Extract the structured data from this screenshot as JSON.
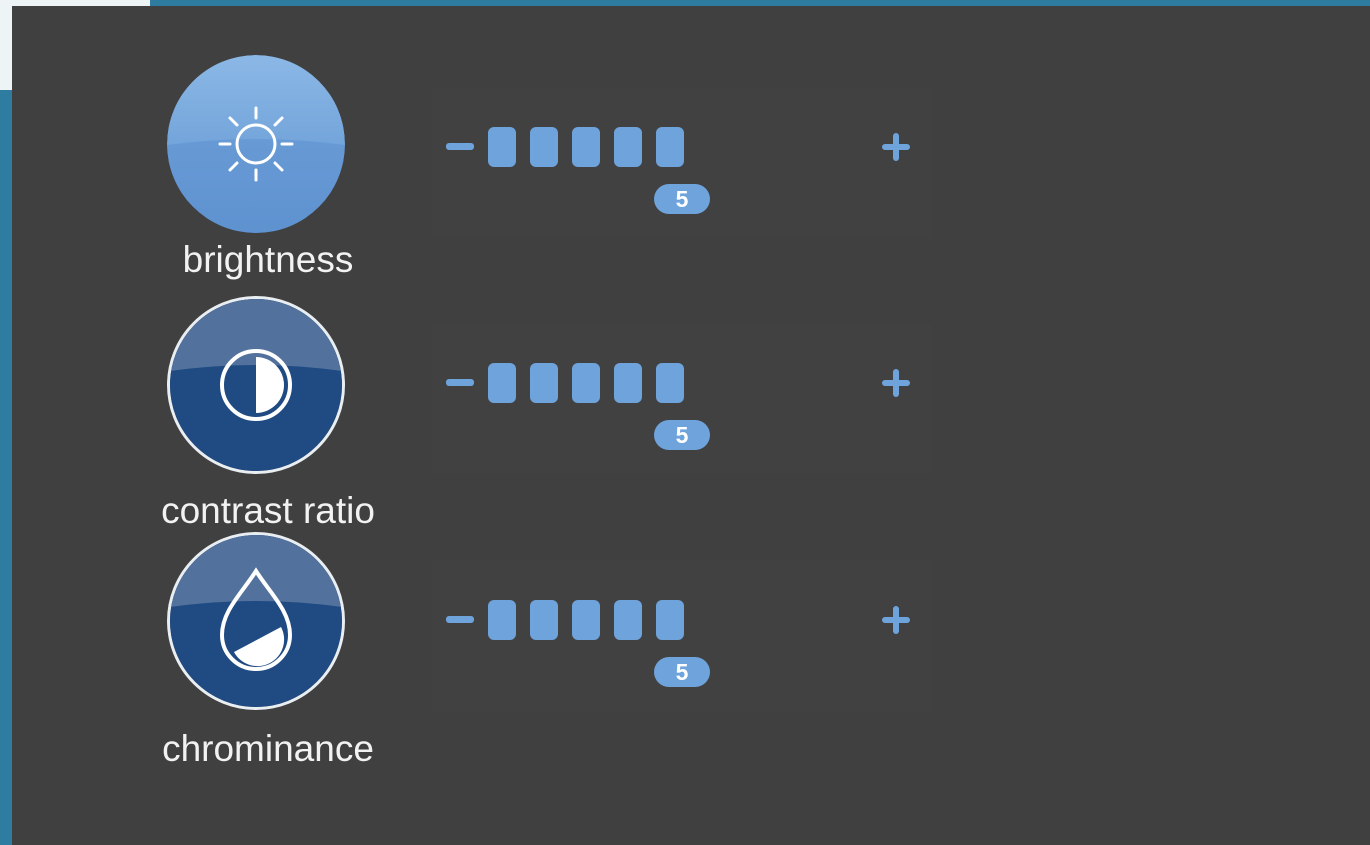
{
  "settings": [
    {
      "label": "brightness",
      "icon": "sun-icon",
      "value": "5",
      "min_label": "−",
      "max_label": "+"
    },
    {
      "label": "contrast ratio",
      "icon": "contrast-icon",
      "value": "5",
      "min_label": "−",
      "max_label": "+"
    },
    {
      "label": "chrominance",
      "icon": "droplet-icon",
      "value": "5",
      "min_label": "−",
      "max_label": "+"
    }
  ],
  "colors": {
    "accent": "#6ea3dc",
    "panel": "#404040",
    "frame": "#2e7ca0"
  }
}
